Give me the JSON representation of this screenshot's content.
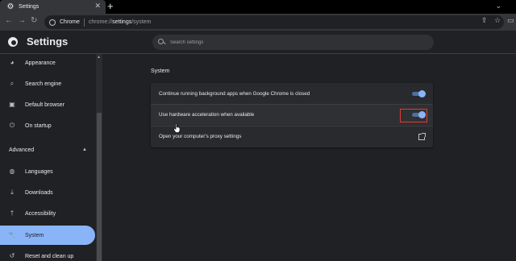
{
  "browser": {
    "tab_title": "Settings",
    "tab_close": "✕",
    "new_tab": "+",
    "tab_menu": "⌄",
    "omnibox_site": "Chrome",
    "url_prefix": "chrome://",
    "url_bold": "settings",
    "url_suffix": "/system"
  },
  "header": {
    "title": "Settings",
    "search_placeholder": "Search settings"
  },
  "sidebar": {
    "items": [
      {
        "label": "Appearance",
        "icon": "palette-icon"
      },
      {
        "label": "Search engine",
        "icon": "search-icon"
      },
      {
        "label": "Default browser",
        "icon": "browser-icon"
      },
      {
        "label": "On startup",
        "icon": "power-icon"
      },
      {
        "label": "Languages",
        "icon": "globe-icon"
      },
      {
        "label": "Downloads",
        "icon": "download-icon"
      },
      {
        "label": "Accessibility",
        "icon": "accessibility-icon"
      },
      {
        "label": "System",
        "icon": "wrench-icon",
        "active": true
      },
      {
        "label": "Reset and clean up",
        "icon": "reset-icon"
      }
    ],
    "advanced_label": "Advanced"
  },
  "main": {
    "section_title": "System",
    "rows": [
      {
        "label": "Continue running background apps when Google Chrome is closed",
        "control": "toggle",
        "checked": true
      },
      {
        "label": "Use hardware acceleration when available",
        "control": "toggle",
        "checked": true,
        "highlighted": true
      },
      {
        "label": "Open your computer's proxy settings",
        "control": "external-link"
      }
    ]
  },
  "colors": {
    "accent": "#8ab4f8",
    "background": "#202124",
    "card": "#292a2d",
    "highlight_box": "#e53935"
  }
}
